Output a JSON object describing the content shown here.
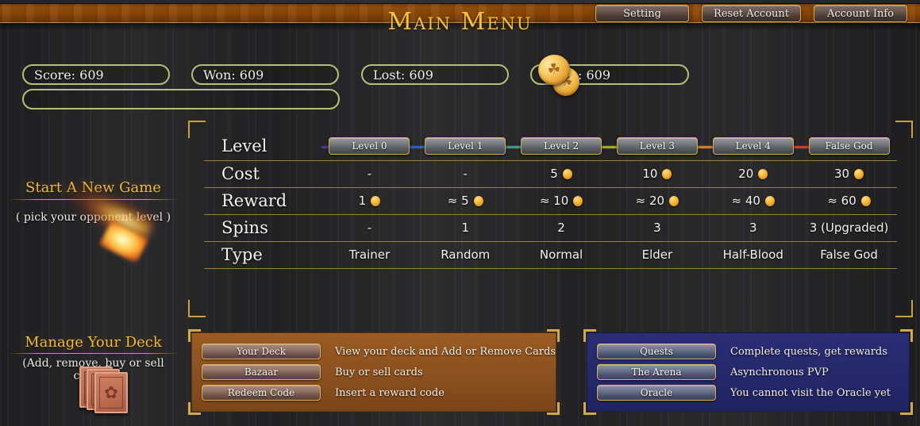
{
  "header": {
    "title": "Main Menu",
    "buttons": [
      {
        "label": "Setting",
        "name": "setting-button"
      },
      {
        "label": "Reset Account",
        "name": "reset-account-button"
      },
      {
        "label": "Account Info",
        "name": "account-info-button"
      }
    ]
  },
  "stats": {
    "score": "Score: 609",
    "won": "Won: 609",
    "lost": "Lost: 609",
    "coins": ": 609",
    "progress_value": ""
  },
  "new_game": {
    "title": "Start A New Game",
    "subtitle": "( pick your opponent level )"
  },
  "deck_section": {
    "title": "Manage Your Deck",
    "subtitle": "(Add, remove, buy or sell cards!)"
  },
  "table": {
    "row_labels": [
      "Level",
      "Cost",
      "Reward",
      "Spins",
      "Type"
    ],
    "columns": [
      {
        "level_label": "Level 0",
        "cost": "-",
        "reward": "1",
        "reward_coin": true,
        "spins": "-",
        "type": "Trainer",
        "cost_coin": false,
        "accent": "#5b3aa8"
      },
      {
        "level_label": "Level 1",
        "cost": "-",
        "reward": "≈ 5",
        "reward_coin": true,
        "spins": "1",
        "type": "Random",
        "cost_coin": false,
        "accent": "#2f5fd0"
      },
      {
        "level_label": "Level 2",
        "cost": "5",
        "reward": "≈ 10",
        "reward_coin": true,
        "spins": "2",
        "type": "Normal",
        "cost_coin": true,
        "accent": "#2a9fc4"
      },
      {
        "level_label": "Level 3",
        "cost": "10",
        "reward": "≈ 20",
        "reward_coin": true,
        "spins": "3",
        "type": "Elder",
        "cost_coin": true,
        "accent": "#8fc23a"
      },
      {
        "level_label": "Level 4",
        "cost": "20",
        "reward": "≈ 40",
        "reward_coin": true,
        "spins": "3",
        "type": "Half-Blood",
        "cost_coin": true,
        "accent": "#e8842a"
      },
      {
        "level_label": "False God",
        "cost": "30",
        "reward": "≈ 60",
        "reward_coin": true,
        "spins": "3 (Upgraded)",
        "type": "False God",
        "cost_coin": true,
        "accent": "#c2281e"
      }
    ]
  },
  "deck_panel": {
    "rows": [
      {
        "button": "Your Deck",
        "desc": "View your deck and Add or Remove Cards",
        "name": "your-deck"
      },
      {
        "button": "Bazaar",
        "desc": "Buy or sell cards",
        "name": "bazaar"
      },
      {
        "button": "Redeem Code",
        "desc": "Insert a reward code",
        "name": "redeem-code"
      }
    ]
  },
  "side_panel": {
    "rows": [
      {
        "button": "Quests",
        "desc": "Complete quests, get rewards",
        "name": "quests"
      },
      {
        "button": "The Arena",
        "desc": "Asynchronous PVP",
        "name": "the-arena"
      },
      {
        "button": "Oracle",
        "desc": "You cannot visit the Oracle yet",
        "name": "oracle"
      }
    ]
  },
  "colors": {
    "gold": "#c9a23c",
    "title_gold": "#f5c23a",
    "pill_border": "#b6bf73",
    "deck_panel_bg": "#8d5220",
    "side_panel_bg": "#262a6d"
  }
}
